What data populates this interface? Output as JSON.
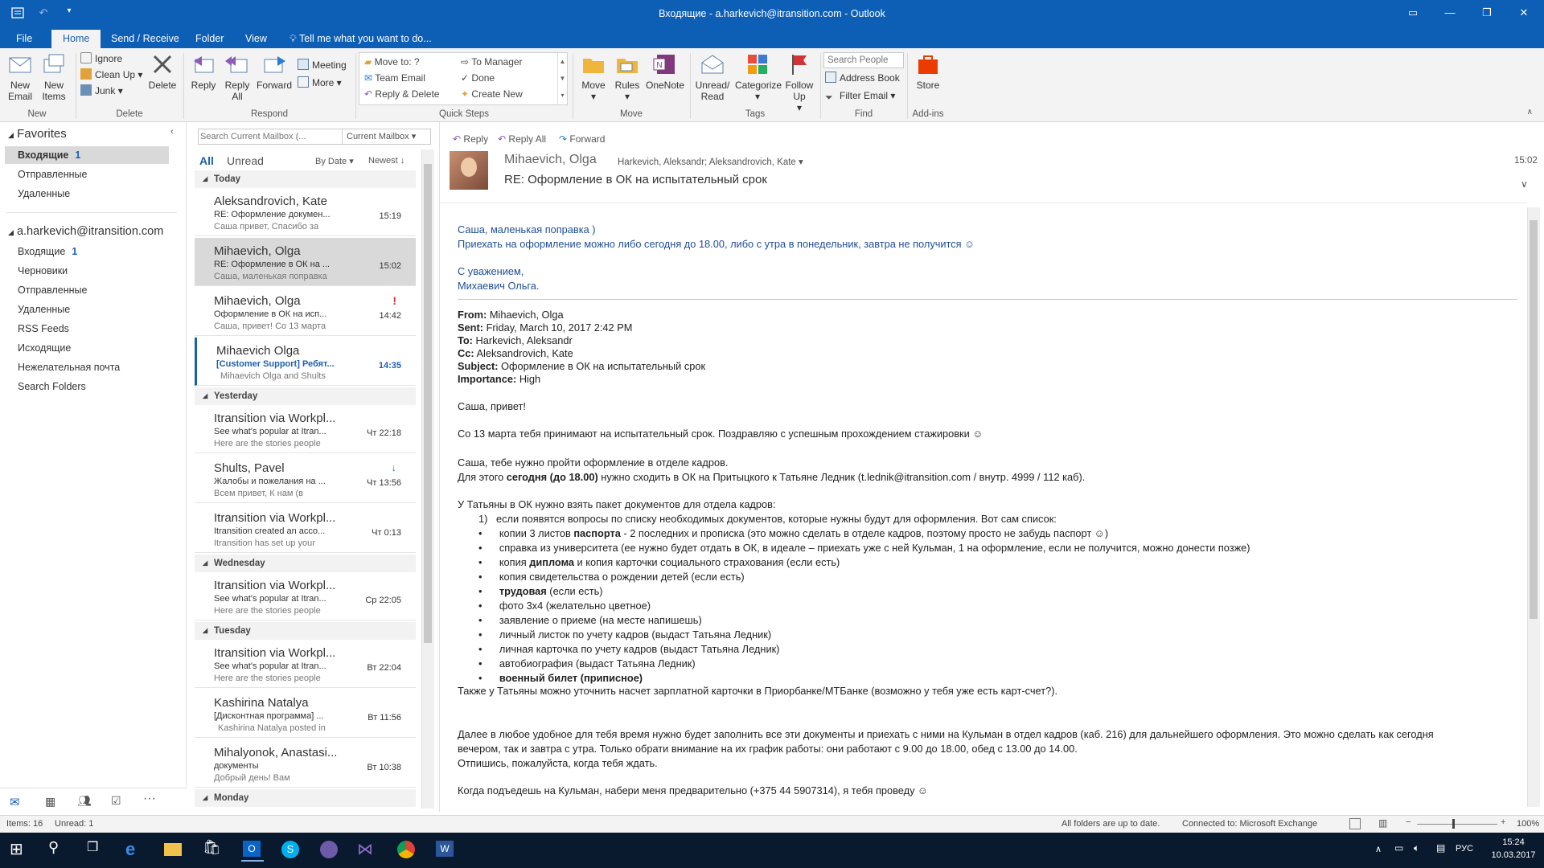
{
  "window": {
    "title": "Входящие - a.harkevich@itransition.com - Outlook"
  },
  "tabs": [
    "File",
    "Home",
    "Send / Receive",
    "Folder",
    "View"
  ],
  "tell_me": "Tell me what you want to do...",
  "ribbon": {
    "new_email": "New Email",
    "new_items": "New Items",
    "ignore": "Ignore",
    "clean_up": "Clean Up",
    "junk": "Junk",
    "delete": "Delete",
    "reply": "Reply",
    "reply_all": "Reply All",
    "forward": "Forward",
    "meeting": "Meeting",
    "more": "More",
    "qs_move_to": "Move to: ?",
    "qs_to_manager": "To Manager",
    "qs_team_email": "Team Email",
    "qs_done": "Done",
    "qs_reply_delete": "Reply & Delete",
    "qs_create_new": "Create New",
    "move": "Move",
    "rules": "Rules",
    "onenote": "OneNote",
    "unread_read": "Unread/ Read",
    "categorize": "Categorize",
    "follow_up": "Follow Up",
    "search_people": "Search People",
    "address_book": "Address Book",
    "filter_email": "Filter Email",
    "store": "Store",
    "groups": {
      "new": "New",
      "delete": "Delete",
      "respond": "Respond",
      "quick_steps": "Quick Steps",
      "move": "Move",
      "tags": "Tags",
      "find": "Find",
      "addins": "Add-ins"
    }
  },
  "nav": {
    "favorites": "Favorites",
    "fav_items": [
      {
        "label": "Входящие",
        "count": "1"
      },
      {
        "label": "Отправленные",
        "count": ""
      },
      {
        "label": "Удаленные",
        "count": ""
      }
    ],
    "account": "a.harkevich@itransition.com",
    "account_items": [
      {
        "label": "Входящие",
        "count": "1"
      },
      {
        "label": "Черновики",
        "count": ""
      },
      {
        "label": "Отправленные",
        "count": ""
      },
      {
        "label": "Удаленные",
        "count": ""
      },
      {
        "label": "RSS Feeds",
        "count": ""
      },
      {
        "label": "Исходящие",
        "count": ""
      },
      {
        "label": "Нежелательная почта",
        "count": ""
      },
      {
        "label": "Search Folders",
        "count": ""
      }
    ]
  },
  "list": {
    "search_placeholder": "Search Current Mailbox (...",
    "scope": "Current Mailbox",
    "filter_all": "All",
    "filter_unread": "Unread",
    "sort_by": "By Date",
    "sort_order": "Newest",
    "groups": {
      "today": "Today",
      "yesterday": "Yesterday",
      "wednesday": "Wednesday",
      "tuesday": "Tuesday",
      "monday": "Monday"
    },
    "messages": [
      {
        "from": "Aleksandrovich, Kate",
        "subject": "RE: Оформление докумен...",
        "preview": "Саша привет,  Спасибо за",
        "time": "15:19"
      },
      {
        "from": "Mihaevich, Olga",
        "subject": "RE: Оформление в ОК на ...",
        "preview": "Саша, маленькая поправка",
        "time": "15:02"
      },
      {
        "from": "Mihaevich, Olga",
        "subject": "Оформление в ОК на исп...",
        "preview": "Саша, привет!  Со 13 марта",
        "time": "14:42"
      },
      {
        "from": "Mihaevich Olga",
        "subject": "[Customer Support] Ребят...",
        "preview": "Mihaevich Olga and Shults",
        "time": "14:35"
      },
      {
        "from": "Itransition via Workpl...",
        "subject": "See what's popular at Itran...",
        "preview": "Here are the stories people",
        "time": "Чт 22:18"
      },
      {
        "from": "Shults, Pavel",
        "subject": "Жалобы и пожелания на ...",
        "preview": "Всем привет,  К нам (в",
        "time": "Чт 13:56"
      },
      {
        "from": "Itransition via Workpl...",
        "subject": "Itransition created an acco...",
        "preview": "Itransition has set up your",
        "time": "Чт 0:13"
      },
      {
        "from": "Itransition via Workpl...",
        "subject": "See what's popular at Itran...",
        "preview": "Here are the stories people",
        "time": "Ср 22:05"
      },
      {
        "from": "Itransition via Workpl...",
        "subject": "See what's popular at Itran...",
        "preview": "Here are the stories people",
        "time": "Вт 22:04"
      },
      {
        "from": "Kashirina Natalya",
        "subject": "[Дисконтная программа] ...",
        "preview": "Kashirina Natalya posted in",
        "time": "Вт 11:56"
      },
      {
        "from": "Mihalyonok, Anastasi...",
        "subject": "документы",
        "preview": "Добрый день! Вам",
        "time": "Вт 10:38"
      }
    ]
  },
  "reading": {
    "actions": [
      "Reply",
      "Reply All",
      "Forward"
    ],
    "sender": "Mihaevich, Olga",
    "recipients": "Harkevich, Aleksandr; Aleksandrovich, Kate",
    "time": "15:02",
    "subject": "RE: Оформление в ОК на испытательный срок",
    "top_lines": [
      "Саша, маленькая поправка )",
      "Приехать на оформление можно либо сегодня до 18.00, либо с утра в понедельник, завтра не получится ☺",
      "С уважением,",
      "Михаевич Ольга."
    ],
    "hdr_from_label": "From:",
    "hdr_from": "Mihaevich, Olga",
    "hdr_sent_label": "Sent:",
    "hdr_sent": "Friday, March 10, 2017 2:42 PM",
    "hdr_to_label": "To:",
    "hdr_to": "Harkevich, Aleksandr",
    "hdr_cc_label": "Cc:",
    "hdr_cc": "Aleksandrovich, Kate",
    "hdr_subject_label": "Subject:",
    "hdr_subject": "Оформление в ОК на испытательный срок",
    "hdr_importance_label": "Importance:",
    "hdr_importance": "High",
    "p1": "Саша, привет!",
    "p2": "Со 13 марта тебя принимают на испытательный срок. Поздравляю с успешным прохождением стажировки ☺",
    "p3": "Саша, тебе нужно пройти оформление в отделе кадров.",
    "p4a": "Для этого ",
    "p4b": "сегодня (до 18.00)",
    "p4c": " нужно сходить в ОК на Притыцкого к Татьяне Ледник (t.lednik@itransition.com / внутр. 4999 / 112 каб).",
    "p5": "У Татьяны в ОК нужно взять пакет документов для отдела кадров:",
    "p6num": "1)",
    "p6": "если появятся вопросы по списку необходимых документов, которые нужны будут для оформления. Вот сам список:",
    "b1a": "копии 3 листов ",
    "b1b": "паспорта",
    "b1c": " - 2 последних и прописка (это можно сделать в отделе кадров, поэтому просто не забудь паспорт ☺)",
    "b2": "справка из университета (ее нужно будет отдать в ОК, в идеале – приехать уже с ней Кульман, 1 на оформление, если не получится, можно донести позже)",
    "b3a": "копия ",
    "b3b": "диплома",
    "b3c": " и копия карточки социального страхования (если есть)",
    "b4": "копия свидетельства о рождении детей (если есть)",
    "b5a": "трудовая",
    "b5b": " (если есть)",
    "b6": "фото 3х4 (желательно цветное)",
    "b7": "заявление о приеме (на месте напишешь)",
    "b8": "личный листок по учету кадров (выдаст Татьяна Ледник)",
    "b9": "личная карточка по учету кадров (выдаст Татьяна Ледник)",
    "b10": "автобиография (выдаст Татьяна Ледник)",
    "b11": "военный билет (приписное)",
    "p7": "Также у Татьяны можно уточнить насчет зарплатной карточки в Приорбанке/МТБанке (возможно у тебя уже есть карт-счет?).",
    "p8a": "Далее в любое удобное для тебя время нужно будет заполнить все эти документы и приехать с ними на Кульман в отдел кадров (каб. 216) для дальнейшего оформления. Это можно сделать как сегодня",
    "p8b": "вечером, так и завтра с утра. Только обрати внимание на их график работы: они работают с 9.00 до 18.00, обед с 13.00 до 14.00.",
    "p8c": "Отпишись, пожалуйста, когда тебя ждать.",
    "p9": "Когда подъедешь на Кульман, набери меня предварительно (+375 44 5907314), я тебя проведу ☺"
  },
  "status": {
    "items": "Items: 16",
    "unread": "Unread: 1",
    "sync": "All folders are up to date.",
    "connected": "Connected to: Microsoft Exchange",
    "zoom": "100%"
  },
  "taskbar": {
    "lang": "РУС",
    "time": "15:24",
    "date": "10.03.2017"
  },
  "colors": {
    "accent": "#0d5eb5",
    "selected": "#cde3f7",
    "link": "#1f4e96",
    "flag": "#d13438"
  }
}
